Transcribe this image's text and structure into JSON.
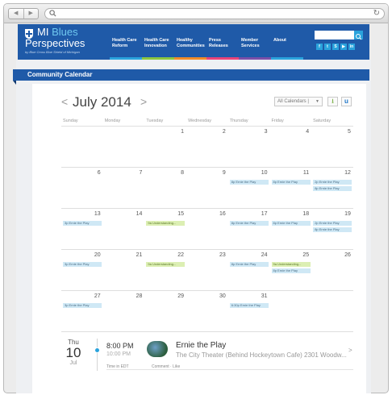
{
  "browser": {
    "nav_back": "◀",
    "nav_fwd": "▶",
    "reload": "↻"
  },
  "site": {
    "logo_line1": "MI",
    "logo_line1_accent": "Blues",
    "logo_line2": "Perspectives",
    "logo_tagline": "by Blue Cross Blue Shield of Michigan",
    "nav": [
      {
        "label": "Health Care Reform",
        "color": "#2aa3dc"
      },
      {
        "label": "Health Care Innovation",
        "color": "#8cc63f"
      },
      {
        "label": "Healthy Communities",
        "color": "#f28c28"
      },
      {
        "label": "Press Releases",
        "color": "#e8437a"
      },
      {
        "label": "Member Services",
        "color": "#7b4fa8"
      },
      {
        "label": "About",
        "color": "#2aa3dc"
      }
    ],
    "social": [
      "f",
      "t",
      "S",
      "▶",
      "in"
    ]
  },
  "section_title": "Community Calendar",
  "calendar": {
    "prev": "<",
    "month_label": "July 2014",
    "next": ">",
    "calendar_select": "All Calendars |",
    "weekdays": [
      "Sunday",
      "Monday",
      "Tuesday",
      "Wednesday",
      "Thursday",
      "Friday",
      "Saturday"
    ],
    "weeks": [
      [
        {
          "n": ""
        },
        {
          "n": ""
        },
        {
          "n": "1"
        },
        {
          "n": "2"
        },
        {
          "n": "3"
        },
        {
          "n": "4"
        },
        {
          "n": "5"
        }
      ],
      [
        {
          "n": "6"
        },
        {
          "n": "7"
        },
        {
          "n": "8"
        },
        {
          "n": "9"
        },
        {
          "n": "10",
          "events": [
            "8p Ernie the Play"
          ]
        },
        {
          "n": "11",
          "events": [
            "8p Ernie the Play"
          ]
        },
        {
          "n": "12",
          "events": [
            "2p Ernie the Play",
            "8p Ernie the Play"
          ]
        }
      ],
      [
        {
          "n": "13",
          "events": [
            "3p Ernie the Play"
          ]
        },
        {
          "n": "14"
        },
        {
          "n": "15",
          "green": [
            "9a Understanding..."
          ]
        },
        {
          "n": "16"
        },
        {
          "n": "17",
          "events": [
            "8p Ernie the Play"
          ]
        },
        {
          "n": "18",
          "events": [
            "8p Ernie the Play"
          ]
        },
        {
          "n": "19",
          "events": [
            "2p Ernie the Play",
            "8p Ernie the Play"
          ]
        }
      ],
      [
        {
          "n": "20",
          "events": [
            "3p Ernie the Play"
          ]
        },
        {
          "n": "21"
        },
        {
          "n": "22",
          "green": [
            "9a Understanding..."
          ]
        },
        {
          "n": "23"
        },
        {
          "n": "24",
          "events": [
            "8p Ernie the Play"
          ]
        },
        {
          "n": "25",
          "green": [
            "9a Understanding..."
          ],
          "events": [
            "8p Ernie the Play"
          ]
        },
        {
          "n": "26"
        }
      ],
      [
        {
          "n": "27",
          "events": [
            "3p Ernie the Play"
          ]
        },
        {
          "n": "28"
        },
        {
          "n": "29"
        },
        {
          "n": "30"
        },
        {
          "n": "31",
          "events": [
            "6:30p Ernie the Play"
          ]
        },
        {
          "n": ""
        },
        {
          "n": ""
        }
      ]
    ]
  },
  "agenda": {
    "dow": "Thu",
    "day": "10",
    "month": "Jul",
    "time": "8:00 PM",
    "end_time": "10:00 PM",
    "timezone": "Time in EDT",
    "title": "Ernie the Play",
    "location": "The City Theater (Behind Hockeytown Cafe) 2301 Woodw...",
    "actions": "Comment  ·  Like",
    "arrow": ">"
  }
}
